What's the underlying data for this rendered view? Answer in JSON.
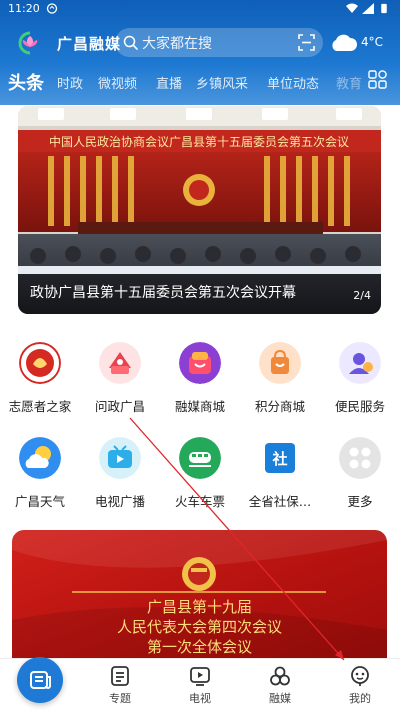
{
  "status_bar": {
    "time": "11:20"
  },
  "header": {
    "app_name": "广昌融媒",
    "search_placeholder": "大家都在搜",
    "weather_temp": "4°C"
  },
  "tabs": [
    {
      "label": "头条"
    },
    {
      "label": "时政"
    },
    {
      "label": "微视频"
    },
    {
      "label": "直播"
    },
    {
      "label": "乡镇风采"
    },
    {
      "label": "单位动态"
    },
    {
      "label": "教育"
    }
  ],
  "banner": {
    "caption": "政协广昌县第十五届委员会第五次会议开幕",
    "pager": "2/4",
    "image_text": "中国人民政治协商会议广昌县第十五届委员会第五次会议"
  },
  "services": [
    {
      "label": "志愿者之家",
      "icon": "volunteer-icon",
      "color": "#d42a22"
    },
    {
      "label": "问政广昌",
      "icon": "inquiry-icon",
      "color": "#e8434f"
    },
    {
      "label": "融媒商城",
      "icon": "shop-icon",
      "color": "#8b3fd3"
    },
    {
      "label": "积分商城",
      "icon": "points-shop-icon",
      "color": "#f08a3a"
    },
    {
      "label": "便民服务",
      "icon": "service-icon",
      "color": "#6a55e0"
    },
    {
      "label": "广昌天气",
      "icon": "weather-icon",
      "color": "#2f8ef0"
    },
    {
      "label": "电视广播",
      "icon": "tv-icon",
      "color": "#2eaee8"
    },
    {
      "label": "火车车票",
      "icon": "train-icon",
      "color": "#24a85a"
    },
    {
      "label": "全省社保…",
      "icon": "social-security-icon",
      "color": "#1a7fd8"
    },
    {
      "label": "更多",
      "icon": "more-icon",
      "color": "#c9c9c9"
    }
  ],
  "poster": {
    "line1": "广昌县第十九届",
    "line2": "人民代表大会第四次会议",
    "line3": "第一次全体会议"
  },
  "bottom_nav": [
    {
      "label": "专题",
      "icon": "topic-icon"
    },
    {
      "label": "电视",
      "icon": "tv-icon"
    },
    {
      "label": "融媒",
      "icon": "media-icon"
    },
    {
      "label": "我的",
      "icon": "profile-icon"
    }
  ],
  "colors": {
    "header_blue": "#1d78d1",
    "accent_red": "#d42a22",
    "fab_blue": "#1f7ad6"
  }
}
